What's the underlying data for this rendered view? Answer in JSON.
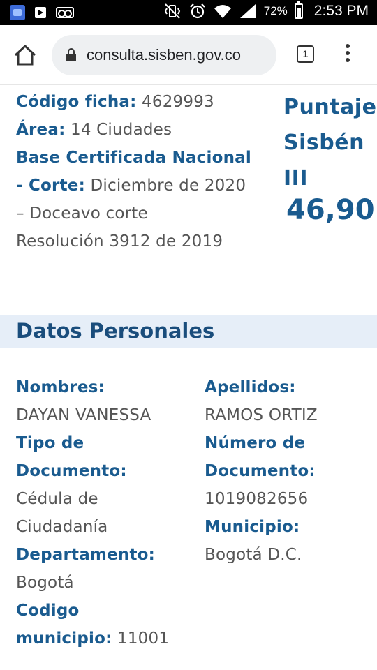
{
  "status_bar": {
    "battery": "72%",
    "time": "2:53 PM"
  },
  "browser": {
    "url": "consulta.sisben.gov.co",
    "tab_count": "1"
  },
  "ficha": {
    "codigo_label": "Código ficha:",
    "codigo_value": "4629993",
    "area_label": "Área:",
    "area_value": "14 Ciudades",
    "base_label_line1": "Base Certificada Nacional",
    "base_label_line2": "- Corte:",
    "base_value_line1": "Diciembre de 2020",
    "base_value_line2": "– Doceavo corte",
    "resolucion": "Resolución 3912 de 2019"
  },
  "puntaje": {
    "title_line1": "Puntaje",
    "title_line2": "Sisbén",
    "title_line3": "III",
    "value": "46,90"
  },
  "datos_personales": {
    "title": "Datos Personales",
    "nombres_label": "Nombres:",
    "nombres_value": "DAYAN VANESSA",
    "apellidos_label": "Apellidos:",
    "apellidos_value": "RAMOS ORTIZ",
    "tipo_doc_label_line1": "Tipo de",
    "tipo_doc_label_line2": "Documento:",
    "tipo_doc_value_line1": "Cédula de",
    "tipo_doc_value_line2": "Ciudadanía",
    "numero_doc_label_line1": "Número de",
    "numero_doc_label_line2": "Documento:",
    "numero_doc_value": "1019082656",
    "municipio_label": "Municipio:",
    "municipio_value": "Bogotá D.C.",
    "departamento_label": "Departamento:",
    "departamento_value": "Bogotá",
    "codigo_municipio_label_line1": "Codigo",
    "codigo_municipio_label_line2": "municipio:",
    "codigo_municipio_value": "11001"
  }
}
